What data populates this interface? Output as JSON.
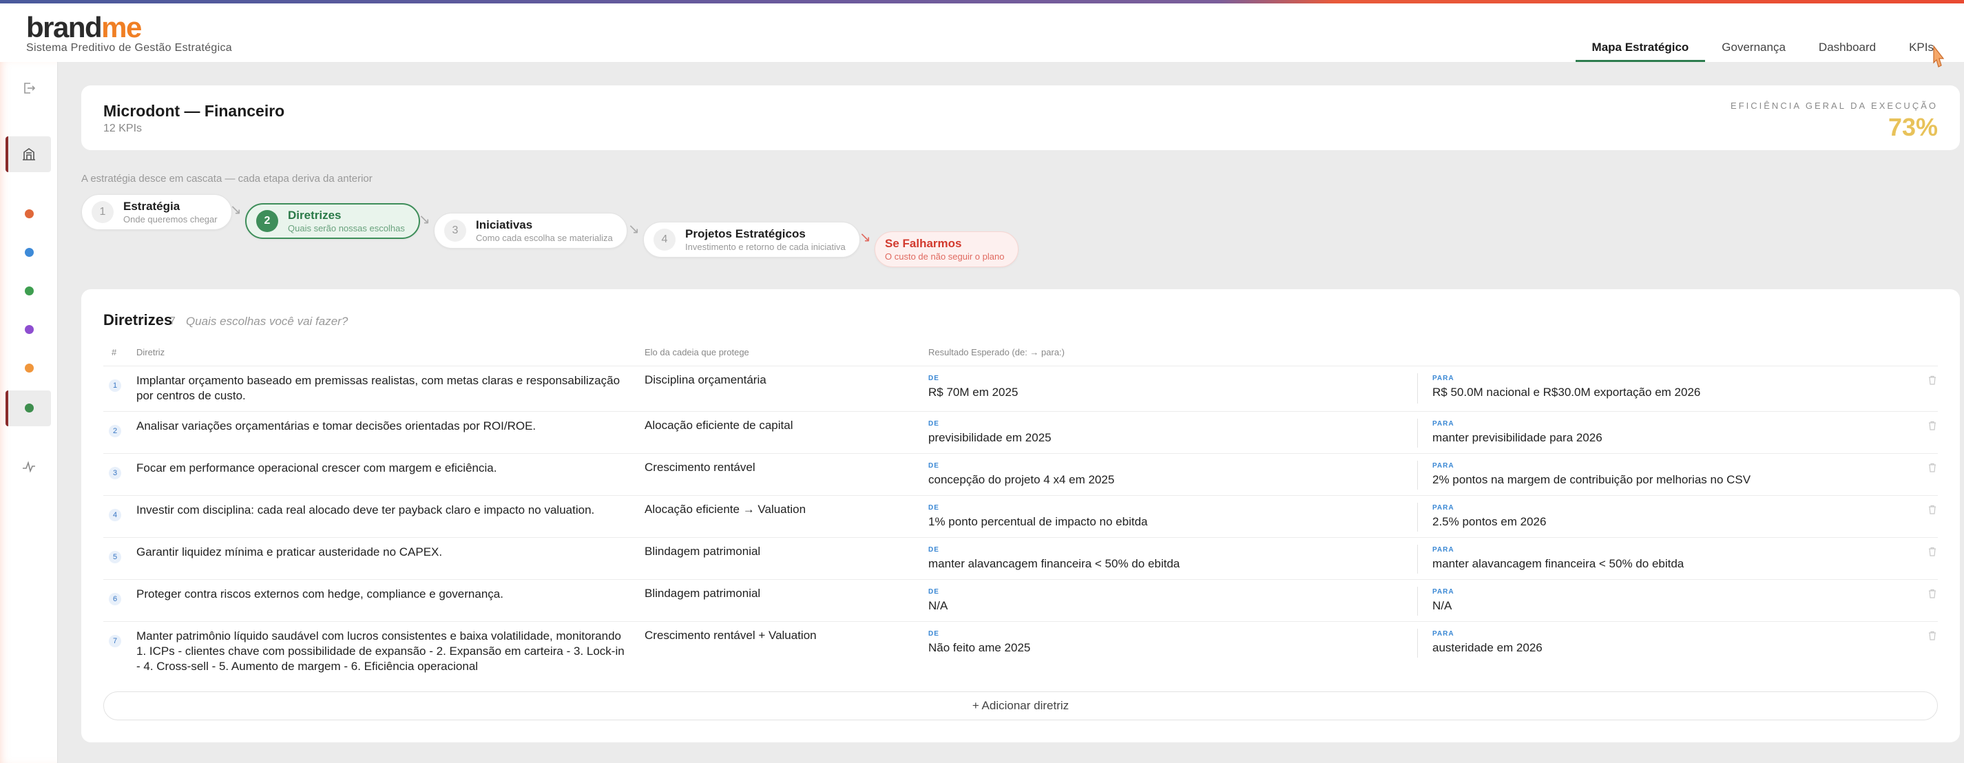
{
  "header": {
    "logo_part1": "brand",
    "logo_part2": "me",
    "tagline": "Sistema Preditivo de Gestão Estratégica",
    "nav": [
      "Mapa Estratégico",
      "Governança",
      "Dashboard",
      "KPIs"
    ],
    "active_nav": "Mapa Estratégico"
  },
  "sidebar": {
    "dot_colors": [
      "#e0683a",
      "#3d8ad8",
      "#3e9e50",
      "#8e4ed0",
      "#f0963c",
      "#3e8e4e"
    ],
    "icons": [
      "logout-icon",
      "building-icon",
      "trend-icon"
    ]
  },
  "summary": {
    "title": "Microdont — Financeiro",
    "kpi_count": "12 KPIs",
    "efficiency_label": "EFICIÊNCIA GERAL DA EXECUÇÃO",
    "efficiency_value": "73%"
  },
  "cascade": {
    "note": "A estratégia desce em cascata — cada etapa deriva da anterior",
    "steps": [
      {
        "num": "1",
        "title": "Estratégia",
        "subtitle": "Onde queremos chegar"
      },
      {
        "num": "2",
        "title": "Diretrizes",
        "subtitle": "Quais serão nossas escolhas"
      },
      {
        "num": "3",
        "title": "Iniciativas",
        "subtitle": "Como cada escolha se materializa"
      },
      {
        "num": "4",
        "title": "Projetos Estratégicos",
        "subtitle": "Investimento e retorno de cada iniciativa"
      },
      {
        "num": "",
        "title": "Se Falharmos",
        "subtitle": "O custo de não seguir o plano"
      }
    ],
    "active_step": 2
  },
  "diretrizes": {
    "title": "Diretrizes",
    "count": "7",
    "subtitle": "Quais escolhas você vai fazer?",
    "columns": [
      "#",
      "Diretriz",
      "Elo da cadeia que protege",
      "Resultado Esperado (de: → para:)"
    ],
    "de_label": "DE",
    "para_label": "PARA",
    "rows": [
      {
        "num": "1",
        "text": "Implantar orçamento baseado em premissas realistas, com metas claras e responsabilização por centros de custo.",
        "elo": "Disciplina orçamentária",
        "de": "R$ 70M em 2025",
        "para": "R$ 50.0M nacional e R$30.0M exportação em 2026"
      },
      {
        "num": "2",
        "text": "Analisar variações orçamentárias e tomar decisões orientadas por ROI/ROE.",
        "elo": "Alocação eficiente de capital",
        "de": "previsibilidade em 2025",
        "para": "manter previsibilidade para 2026"
      },
      {
        "num": "3",
        "text": "Focar em performance operacional crescer com margem e eficiência.",
        "elo": "Crescimento rentável",
        "de": "concepção do projeto 4 x4 em 2025",
        "para": "2% pontos na margem de contribuição por melhorias no CSV"
      },
      {
        "num": "4",
        "text": "Investir com disciplina: cada real alocado deve ter payback claro e impacto no valuation.",
        "elo": "Alocação eficiente → Valuation",
        "de": "1% ponto percentual de impacto no ebitda",
        "para": "2.5% pontos em 2026"
      },
      {
        "num": "5",
        "text": "Garantir liquidez mínima e praticar austeridade no CAPEX.",
        "elo": "Blindagem patrimonial",
        "de": "manter alavancagem financeira < 50% do ebitda",
        "para": "manter alavancagem financeira < 50% do ebitda"
      },
      {
        "num": "6",
        "text": "Proteger contra riscos externos com hedge, compliance e governança.",
        "elo": "Blindagem patrimonial",
        "de": "N/A",
        "para": "N/A"
      },
      {
        "num": "7",
        "text": "Manter patrimônio líquido saudável com lucros consistentes e baixa volatilidade, monitorando 1. ICPs - clientes chave com possibilidade de expansão - 2. Expansão em carteira - 3. Lock-in - 4. Cross-sell - 5. Aumento de margem - 6. Eficiência operacional",
        "elo": "Crescimento rentável + Valuation",
        "de": "Não feito ame 2025",
        "para": "austeridade em 2026"
      }
    ],
    "add_label": "+ Adicionar diretriz"
  }
}
